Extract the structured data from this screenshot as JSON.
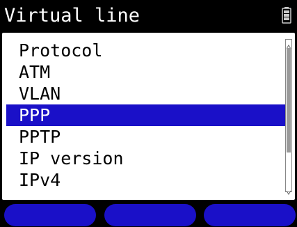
{
  "window": {
    "title": "Virtual line",
    "battery_icon": "battery-icon"
  },
  "menu": {
    "items": [
      {
        "label": "Protocol",
        "selected": false
      },
      {
        "label": "ATM",
        "selected": false
      },
      {
        "label": "VLAN",
        "selected": false
      },
      {
        "label": "PPP",
        "selected": true
      },
      {
        "label": "PPTP",
        "selected": false
      },
      {
        "label": "IP version",
        "selected": false
      },
      {
        "label": "IPv4",
        "selected": false
      }
    ]
  },
  "softkeys": [
    {
      "label": ""
    },
    {
      "label": ""
    },
    {
      "label": ""
    }
  ],
  "colors": {
    "accent": "#1a10c8",
    "background": "#000000",
    "panel": "#ffffff"
  }
}
